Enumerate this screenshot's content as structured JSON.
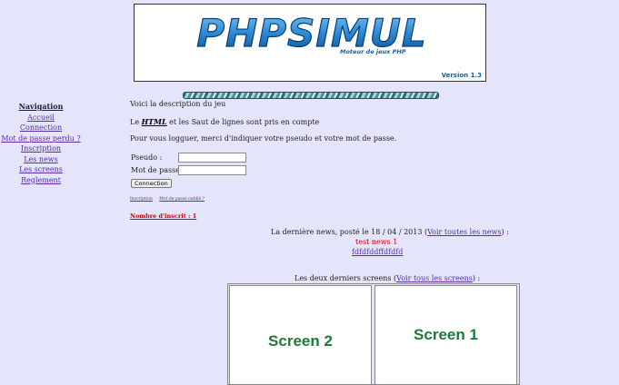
{
  "header": {
    "logo_text": "PHPSIMUL",
    "tagline": "Moteur de jeux PHP",
    "version": "Version 1.3"
  },
  "sidebar": {
    "heading": "Navigation",
    "items": [
      {
        "label": "Accueil"
      },
      {
        "label": "Connection"
      },
      {
        "label": "Mot de passe perdu ?"
      },
      {
        "label": "Inscription"
      },
      {
        "label": "Les news"
      },
      {
        "label": "Les screens"
      },
      {
        "label": "Reglement"
      }
    ]
  },
  "main": {
    "description": "Voici la description du jeu",
    "html_note_prefix": "Le ",
    "html_note_bold": "HTML",
    "html_note_suffix": " et les Saut de lignes sont pris en compte",
    "login_prompt": "Pour vous logguer, merci d'indiquer votre pseudo et votre mot de passe.",
    "pseudo_label": "Pseudo :",
    "pseudo_value": "",
    "password_label": "Mot de passe :",
    "password_value": "",
    "connect_button": "Connection",
    "small_links": [
      "Inscription",
      "Mot de passe oublié ?"
    ],
    "member_count": "Nombre d'inscrit : 1"
  },
  "news": {
    "prefix": "La dernière news, posté le 18 / 04 / 2013 (",
    "link": "Voir toutes les news",
    "suffix": ") :",
    "title": "test news 1",
    "body": "fdfdfddffdfdfd"
  },
  "screens": {
    "prefix": "Les deux derniers screens (",
    "link": "Voir tous les screens",
    "suffix": ") :",
    "items": [
      {
        "label": "Screen 2"
      },
      {
        "label": "Screen 1"
      }
    ]
  },
  "colors": {
    "background": "#e4e4fa",
    "link": "#5a2aa8",
    "accent_red": "#cc0000",
    "screen_green": "#1f7a3a",
    "logo_blue": "#1a5d9c"
  }
}
